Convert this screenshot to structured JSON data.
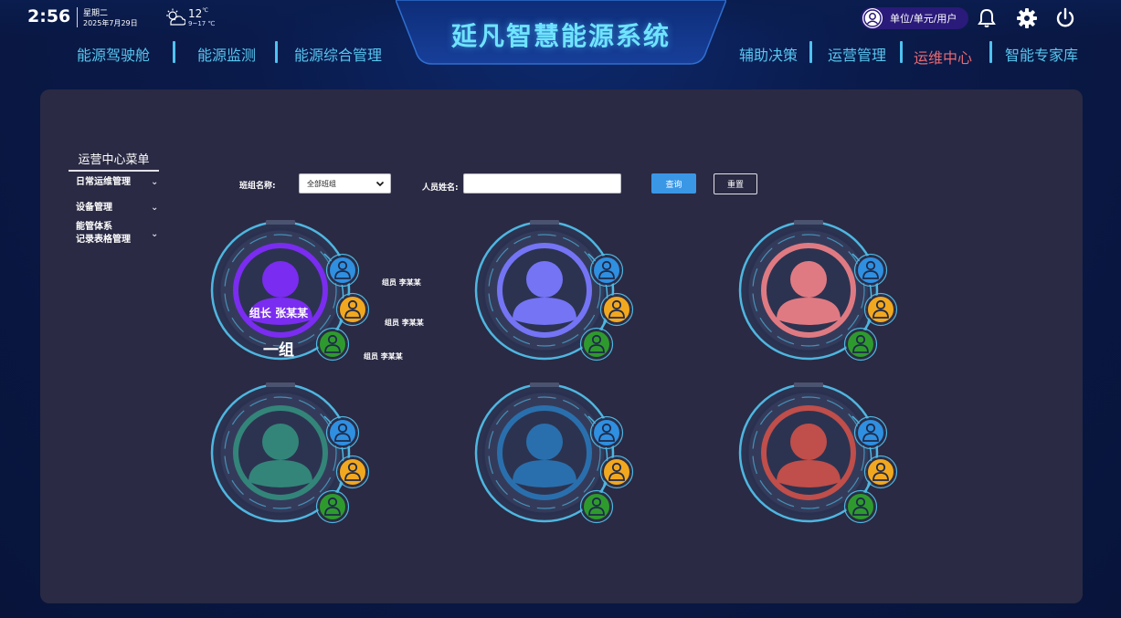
{
  "header": {
    "time": "2:56",
    "weekday": "星期二",
    "date": "2025年7月29日",
    "temp": "12",
    "temp_unit": "℃",
    "temp_range": "9~17 ℃",
    "title": "延凡智慧能源系统",
    "user_label": "单位/单元/用户",
    "nav_left": [
      "能源驾驶舱",
      "能源监测",
      "能源综合管理"
    ],
    "nav_right": [
      "辅助决策",
      "运营管理",
      "运维中心",
      "智能专家库"
    ],
    "active_nav": "运维中心",
    "colors": {
      "title": "#6fe3ff",
      "nav": "#58c6ef",
      "nav_active": "#e86a72"
    }
  },
  "sidebar": {
    "title": "运营中心菜单",
    "items": [
      {
        "label": "日常运维管理"
      },
      {
        "label": "设备管理"
      },
      {
        "label": "能管体系",
        "label2": "记录表格管理"
      }
    ]
  },
  "filters": {
    "group_label": "班组名称:",
    "group_value": "全部班组",
    "person_label": "人员姓名:",
    "person_value": "",
    "query_label": "查询",
    "reset_label": "重置"
  },
  "groups": [
    {
      "color": "#7a2cf0",
      "leader": "组长 张某某",
      "name": "一组",
      "members": [
        "组员 李某某",
        "组员 李某某",
        "组员 李某某"
      ]
    },
    {
      "color": "#7474f5"
    },
    {
      "color": "#e07a82"
    },
    {
      "color": "#33857a"
    },
    {
      "color": "#2a6fad"
    },
    {
      "color": "#c04e4a"
    }
  ],
  "member_colors": [
    "#2f8fe0",
    "#f2a81e",
    "#2e9a2e"
  ]
}
